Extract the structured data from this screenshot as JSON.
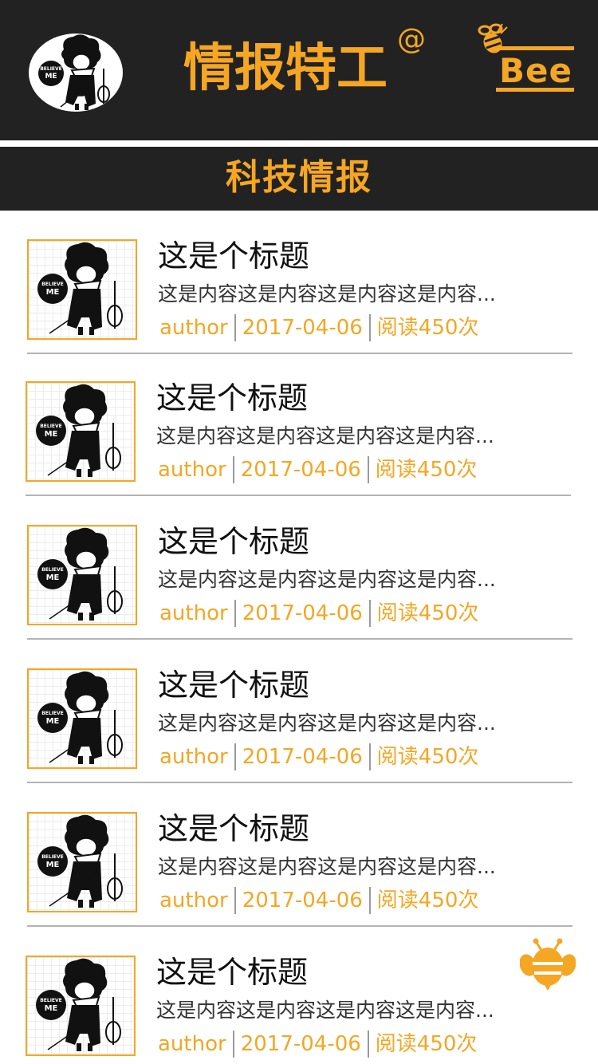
{
  "header": {
    "title": "情报特工",
    "title_superscript": "@",
    "logo_text": "Bee"
  },
  "section": {
    "title": "科技情报"
  },
  "articles": [
    {
      "title": "这是个标题",
      "summary": "这是内容这是内容这是内容这是内容...",
      "author": "author",
      "date": "2017-04-06",
      "reads": "阅读450次"
    },
    {
      "title": "这是个标题",
      "summary": "这是内容这是内容这是内容这是内容...",
      "author": "author",
      "date": "2017-04-06",
      "reads": "阅读450次"
    },
    {
      "title": "这是个标题",
      "summary": "这是内容这是内容这是内容这是内容...",
      "author": "author",
      "date": "2017-04-06",
      "reads": "阅读450次"
    },
    {
      "title": "这是个标题",
      "summary": "这是内容这是内容这是内容这是内容...",
      "author": "author",
      "date": "2017-04-06",
      "reads": "阅读450次"
    },
    {
      "title": "这是个标题",
      "summary": "这是内容这是内容这是内容这是内容...",
      "author": "author",
      "date": "2017-04-06",
      "reads": "阅读450次"
    },
    {
      "title": "这是个标题",
      "summary": "这是内容这是内容这是内容这是内容...",
      "author": "author",
      "date": "2017-04-06",
      "reads": "阅读450次"
    }
  ],
  "thumbnail_badge": {
    "line1": "BELIEVE",
    "line2": "ME"
  },
  "colors": {
    "accent": "#f5a623",
    "header_bg": "#222222",
    "divider": "#b3b3b3"
  },
  "icons": {
    "avatar": "violinist-avatar-icon",
    "logo": "bee-logo-icon",
    "floating": "bee-icon"
  }
}
